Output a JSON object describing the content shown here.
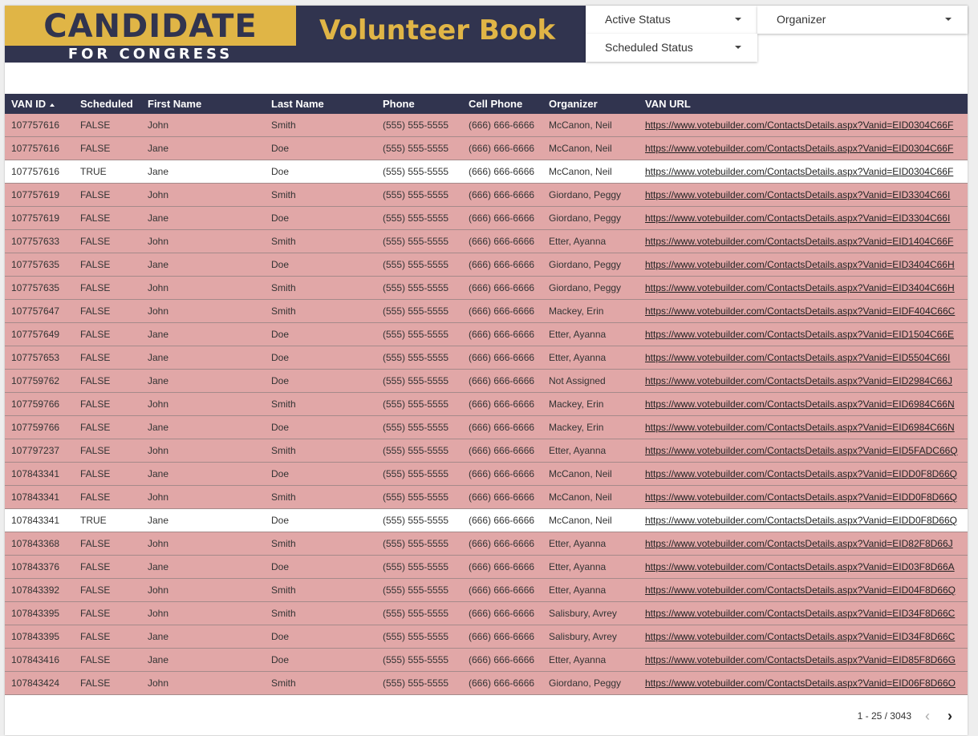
{
  "header": {
    "logo_main": "CANDIDATE",
    "logo_sub": "FOR CONGRESS",
    "title": "Volunteer Book"
  },
  "filters": {
    "active_status": "Active Status",
    "organizer": "Organizer",
    "scheduled_status": "Scheduled Status"
  },
  "colors": {
    "navy": "#31344f",
    "gold": "#e0b546",
    "unscheduled_row": "#e1a7a7",
    "scheduled_row": "#ffffff"
  },
  "table": {
    "columns": [
      "VAN ID",
      "Scheduled",
      "First Name",
      "Last Name",
      "Phone",
      "Cell Phone",
      "Organizer",
      "VAN URL"
    ],
    "sort": {
      "column": "VAN ID",
      "direction": "ascending",
      "icon": "sort-asc-icon"
    },
    "rows": [
      [
        "107757616",
        "FALSE",
        "John",
        "Smith",
        "(555) 555-5555",
        "(666) 666-6666",
        "McCanon, Neil",
        "https://www.votebuilder.com/ContactsDetails.aspx?Vanid=EID0304C66F"
      ],
      [
        "107757616",
        "FALSE",
        "Jane",
        "Doe",
        "(555) 555-5555",
        "(666) 666-6666",
        "McCanon, Neil",
        "https://www.votebuilder.com/ContactsDetails.aspx?Vanid=EID0304C66F"
      ],
      [
        "107757616",
        "TRUE",
        "Jane",
        "Doe",
        "(555) 555-5555",
        "(666) 666-6666",
        "McCanon, Neil",
        "https://www.votebuilder.com/ContactsDetails.aspx?Vanid=EID0304C66F"
      ],
      [
        "107757619",
        "FALSE",
        "John",
        "Smith",
        "(555) 555-5555",
        "(666) 666-6666",
        "Giordano, Peggy",
        "https://www.votebuilder.com/ContactsDetails.aspx?Vanid=EID3304C66I"
      ],
      [
        "107757619",
        "FALSE",
        "Jane",
        "Doe",
        "(555) 555-5555",
        "(666) 666-6666",
        "Giordano, Peggy",
        "https://www.votebuilder.com/ContactsDetails.aspx?Vanid=EID3304C66I"
      ],
      [
        "107757633",
        "FALSE",
        "John",
        "Smith",
        "(555) 555-5555",
        "(666) 666-6666",
        "Etter, Ayanna",
        "https://www.votebuilder.com/ContactsDetails.aspx?Vanid=EID1404C66F"
      ],
      [
        "107757635",
        "FALSE",
        "Jane",
        "Doe",
        "(555) 555-5555",
        "(666) 666-6666",
        "Giordano, Peggy",
        "https://www.votebuilder.com/ContactsDetails.aspx?Vanid=EID3404C66H"
      ],
      [
        "107757635",
        "FALSE",
        "John",
        "Smith",
        "(555) 555-5555",
        "(666) 666-6666",
        "Giordano, Peggy",
        "https://www.votebuilder.com/ContactsDetails.aspx?Vanid=EID3404C66H"
      ],
      [
        "107757647",
        "FALSE",
        "John",
        "Smith",
        "(555) 555-5555",
        "(666) 666-6666",
        "Mackey, Erin",
        "https://www.votebuilder.com/ContactsDetails.aspx?Vanid=EIDF404C66C"
      ],
      [
        "107757649",
        "FALSE",
        "Jane",
        "Doe",
        "(555) 555-5555",
        "(666) 666-6666",
        "Etter, Ayanna",
        "https://www.votebuilder.com/ContactsDetails.aspx?Vanid=EID1504C66E"
      ],
      [
        "107757653",
        "FALSE",
        "Jane",
        "Doe",
        "(555) 555-5555",
        "(666) 666-6666",
        "Etter, Ayanna",
        "https://www.votebuilder.com/ContactsDetails.aspx?Vanid=EID5504C66I"
      ],
      [
        "107759762",
        "FALSE",
        "Jane",
        "Doe",
        "(555) 555-5555",
        "(666) 666-6666",
        "Not Assigned",
        "https://www.votebuilder.com/ContactsDetails.aspx?Vanid=EID2984C66J"
      ],
      [
        "107759766",
        "FALSE",
        "John",
        "Smith",
        "(555) 555-5555",
        "(666) 666-6666",
        "Mackey, Erin",
        "https://www.votebuilder.com/ContactsDetails.aspx?Vanid=EID6984C66N"
      ],
      [
        "107759766",
        "FALSE",
        "Jane",
        "Doe",
        "(555) 555-5555",
        "(666) 666-6666",
        "Mackey, Erin",
        "https://www.votebuilder.com/ContactsDetails.aspx?Vanid=EID6984C66N"
      ],
      [
        "107797237",
        "FALSE",
        "John",
        "Smith",
        "(555) 555-5555",
        "(666) 666-6666",
        "Etter, Ayanna",
        "https://www.votebuilder.com/ContactsDetails.aspx?Vanid=EID5FADC66Q"
      ],
      [
        "107843341",
        "FALSE",
        "Jane",
        "Doe",
        "(555) 555-5555",
        "(666) 666-6666",
        "McCanon, Neil",
        "https://www.votebuilder.com/ContactsDetails.aspx?Vanid=EIDD0F8D66Q"
      ],
      [
        "107843341",
        "FALSE",
        "John",
        "Smith",
        "(555) 555-5555",
        "(666) 666-6666",
        "McCanon, Neil",
        "https://www.votebuilder.com/ContactsDetails.aspx?Vanid=EIDD0F8D66Q"
      ],
      [
        "107843341",
        "TRUE",
        "Jane",
        "Doe",
        "(555) 555-5555",
        "(666) 666-6666",
        "McCanon, Neil",
        "https://www.votebuilder.com/ContactsDetails.aspx?Vanid=EIDD0F8D66Q"
      ],
      [
        "107843368",
        "FALSE",
        "John",
        "Smith",
        "(555) 555-5555",
        "(666) 666-6666",
        "Etter, Ayanna",
        "https://www.votebuilder.com/ContactsDetails.aspx?Vanid=EID82F8D66J"
      ],
      [
        "107843376",
        "FALSE",
        "Jane",
        "Doe",
        "(555) 555-5555",
        "(666) 666-6666",
        "Etter, Ayanna",
        "https://www.votebuilder.com/ContactsDetails.aspx?Vanid=EID03F8D66A"
      ],
      [
        "107843392",
        "FALSE",
        "John",
        "Smith",
        "(555) 555-5555",
        "(666) 666-6666",
        "Etter, Ayanna",
        "https://www.votebuilder.com/ContactsDetails.aspx?Vanid=EID04F8D66Q"
      ],
      [
        "107843395",
        "FALSE",
        "John",
        "Smith",
        "(555) 555-5555",
        "(666) 666-6666",
        "Salisbury, Avrey",
        "https://www.votebuilder.com/ContactsDetails.aspx?Vanid=EID34F8D66C"
      ],
      [
        "107843395",
        "FALSE",
        "Jane",
        "Doe",
        "(555) 555-5555",
        "(666) 666-6666",
        "Salisbury, Avrey",
        "https://www.votebuilder.com/ContactsDetails.aspx?Vanid=EID34F8D66C"
      ],
      [
        "107843416",
        "FALSE",
        "Jane",
        "Doe",
        "(555) 555-5555",
        "(666) 666-6666",
        "Etter, Ayanna",
        "https://www.votebuilder.com/ContactsDetails.aspx?Vanid=EID85F8D66G"
      ],
      [
        "107843424",
        "FALSE",
        "John",
        "Smith",
        "(555) 555-5555",
        "(666) 666-6666",
        "Giordano, Peggy",
        "https://www.votebuilder.com/ContactsDetails.aspx?Vanid=EID06F8D66O"
      ]
    ]
  },
  "pagination": {
    "text": "1 - 25 / 3043",
    "prev_icon": "chevron-left-icon",
    "next_icon": "chevron-right-icon"
  }
}
